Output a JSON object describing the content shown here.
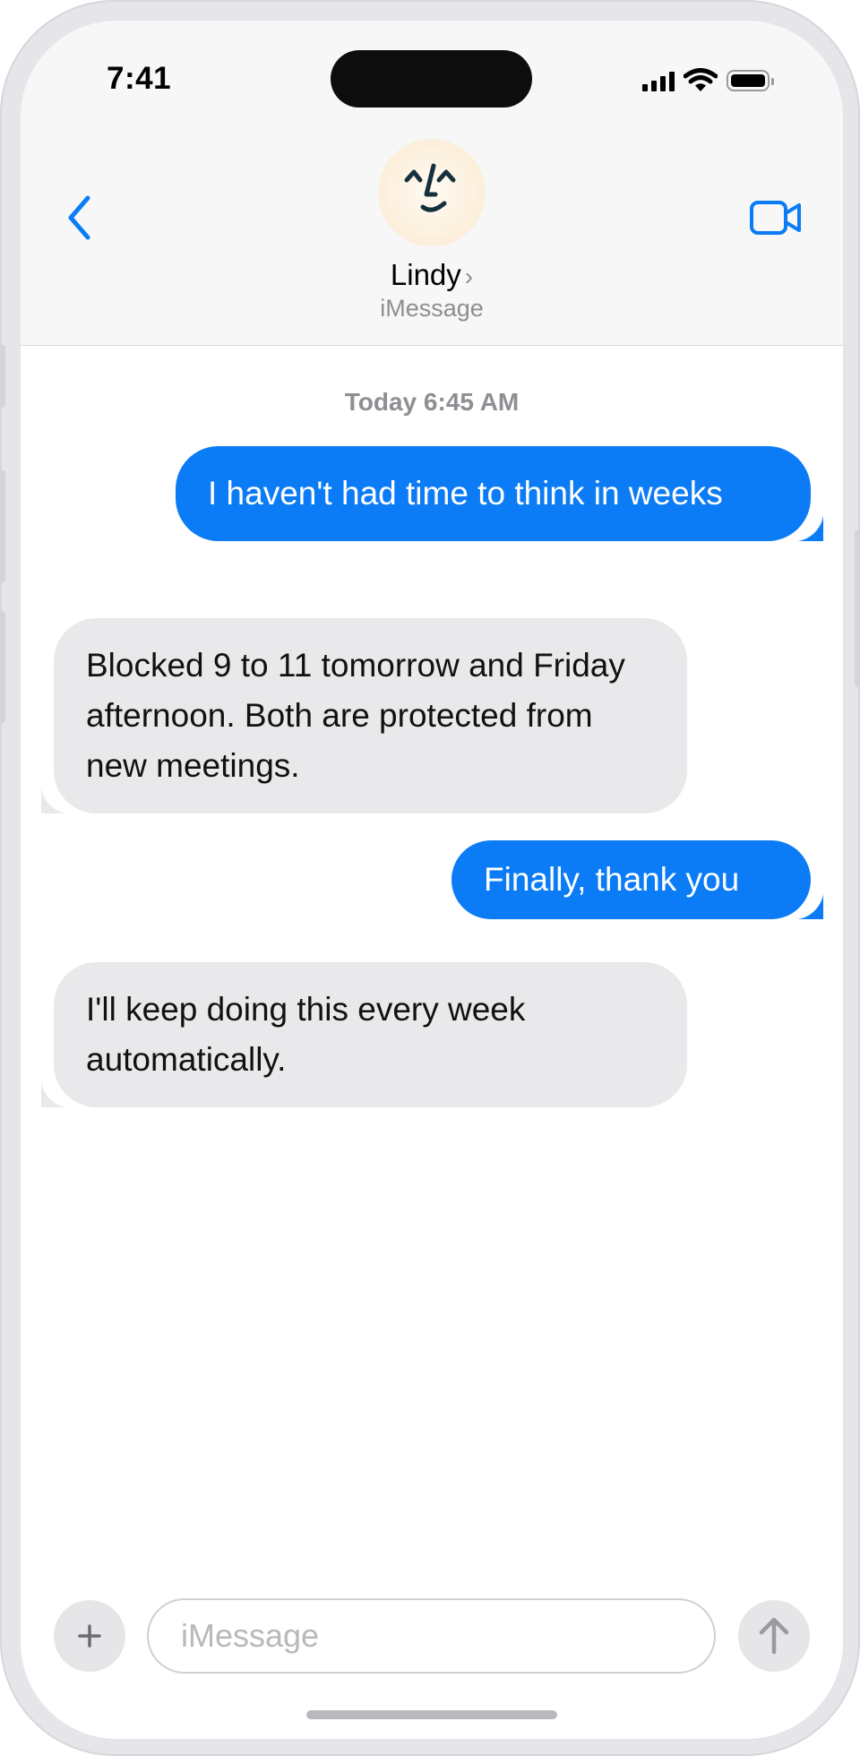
{
  "status_bar": {
    "time": "7:41"
  },
  "header": {
    "contact_name": "Lindy",
    "chevron": "›",
    "service": "iMessage",
    "back_icon": "chevron-left-icon",
    "video_icon": "video-camera-icon",
    "avatar_icon": "face-avatar-icon"
  },
  "conversation": {
    "timestamp": "Today 6:45 AM",
    "messages": [
      {
        "direction": "outgoing",
        "text": "I haven't had time to think in weeks"
      },
      {
        "direction": "incoming",
        "text": "Blocked 9 to 11 tomorrow and Friday afternoon. Both are protected from new meetings."
      },
      {
        "direction": "outgoing",
        "text": "Finally, thank you"
      },
      {
        "direction": "incoming",
        "text": "I'll keep doing this every week automatically."
      }
    ]
  },
  "composer": {
    "placeholder": "iMessage",
    "add_label": "+",
    "send_icon": "arrow-up-icon"
  },
  "colors": {
    "accent": "#0b7cf5",
    "incoming_bubble": "#e9e9eb",
    "header_bg": "#f7f7f7",
    "secondary_text": "#8e8e93"
  }
}
